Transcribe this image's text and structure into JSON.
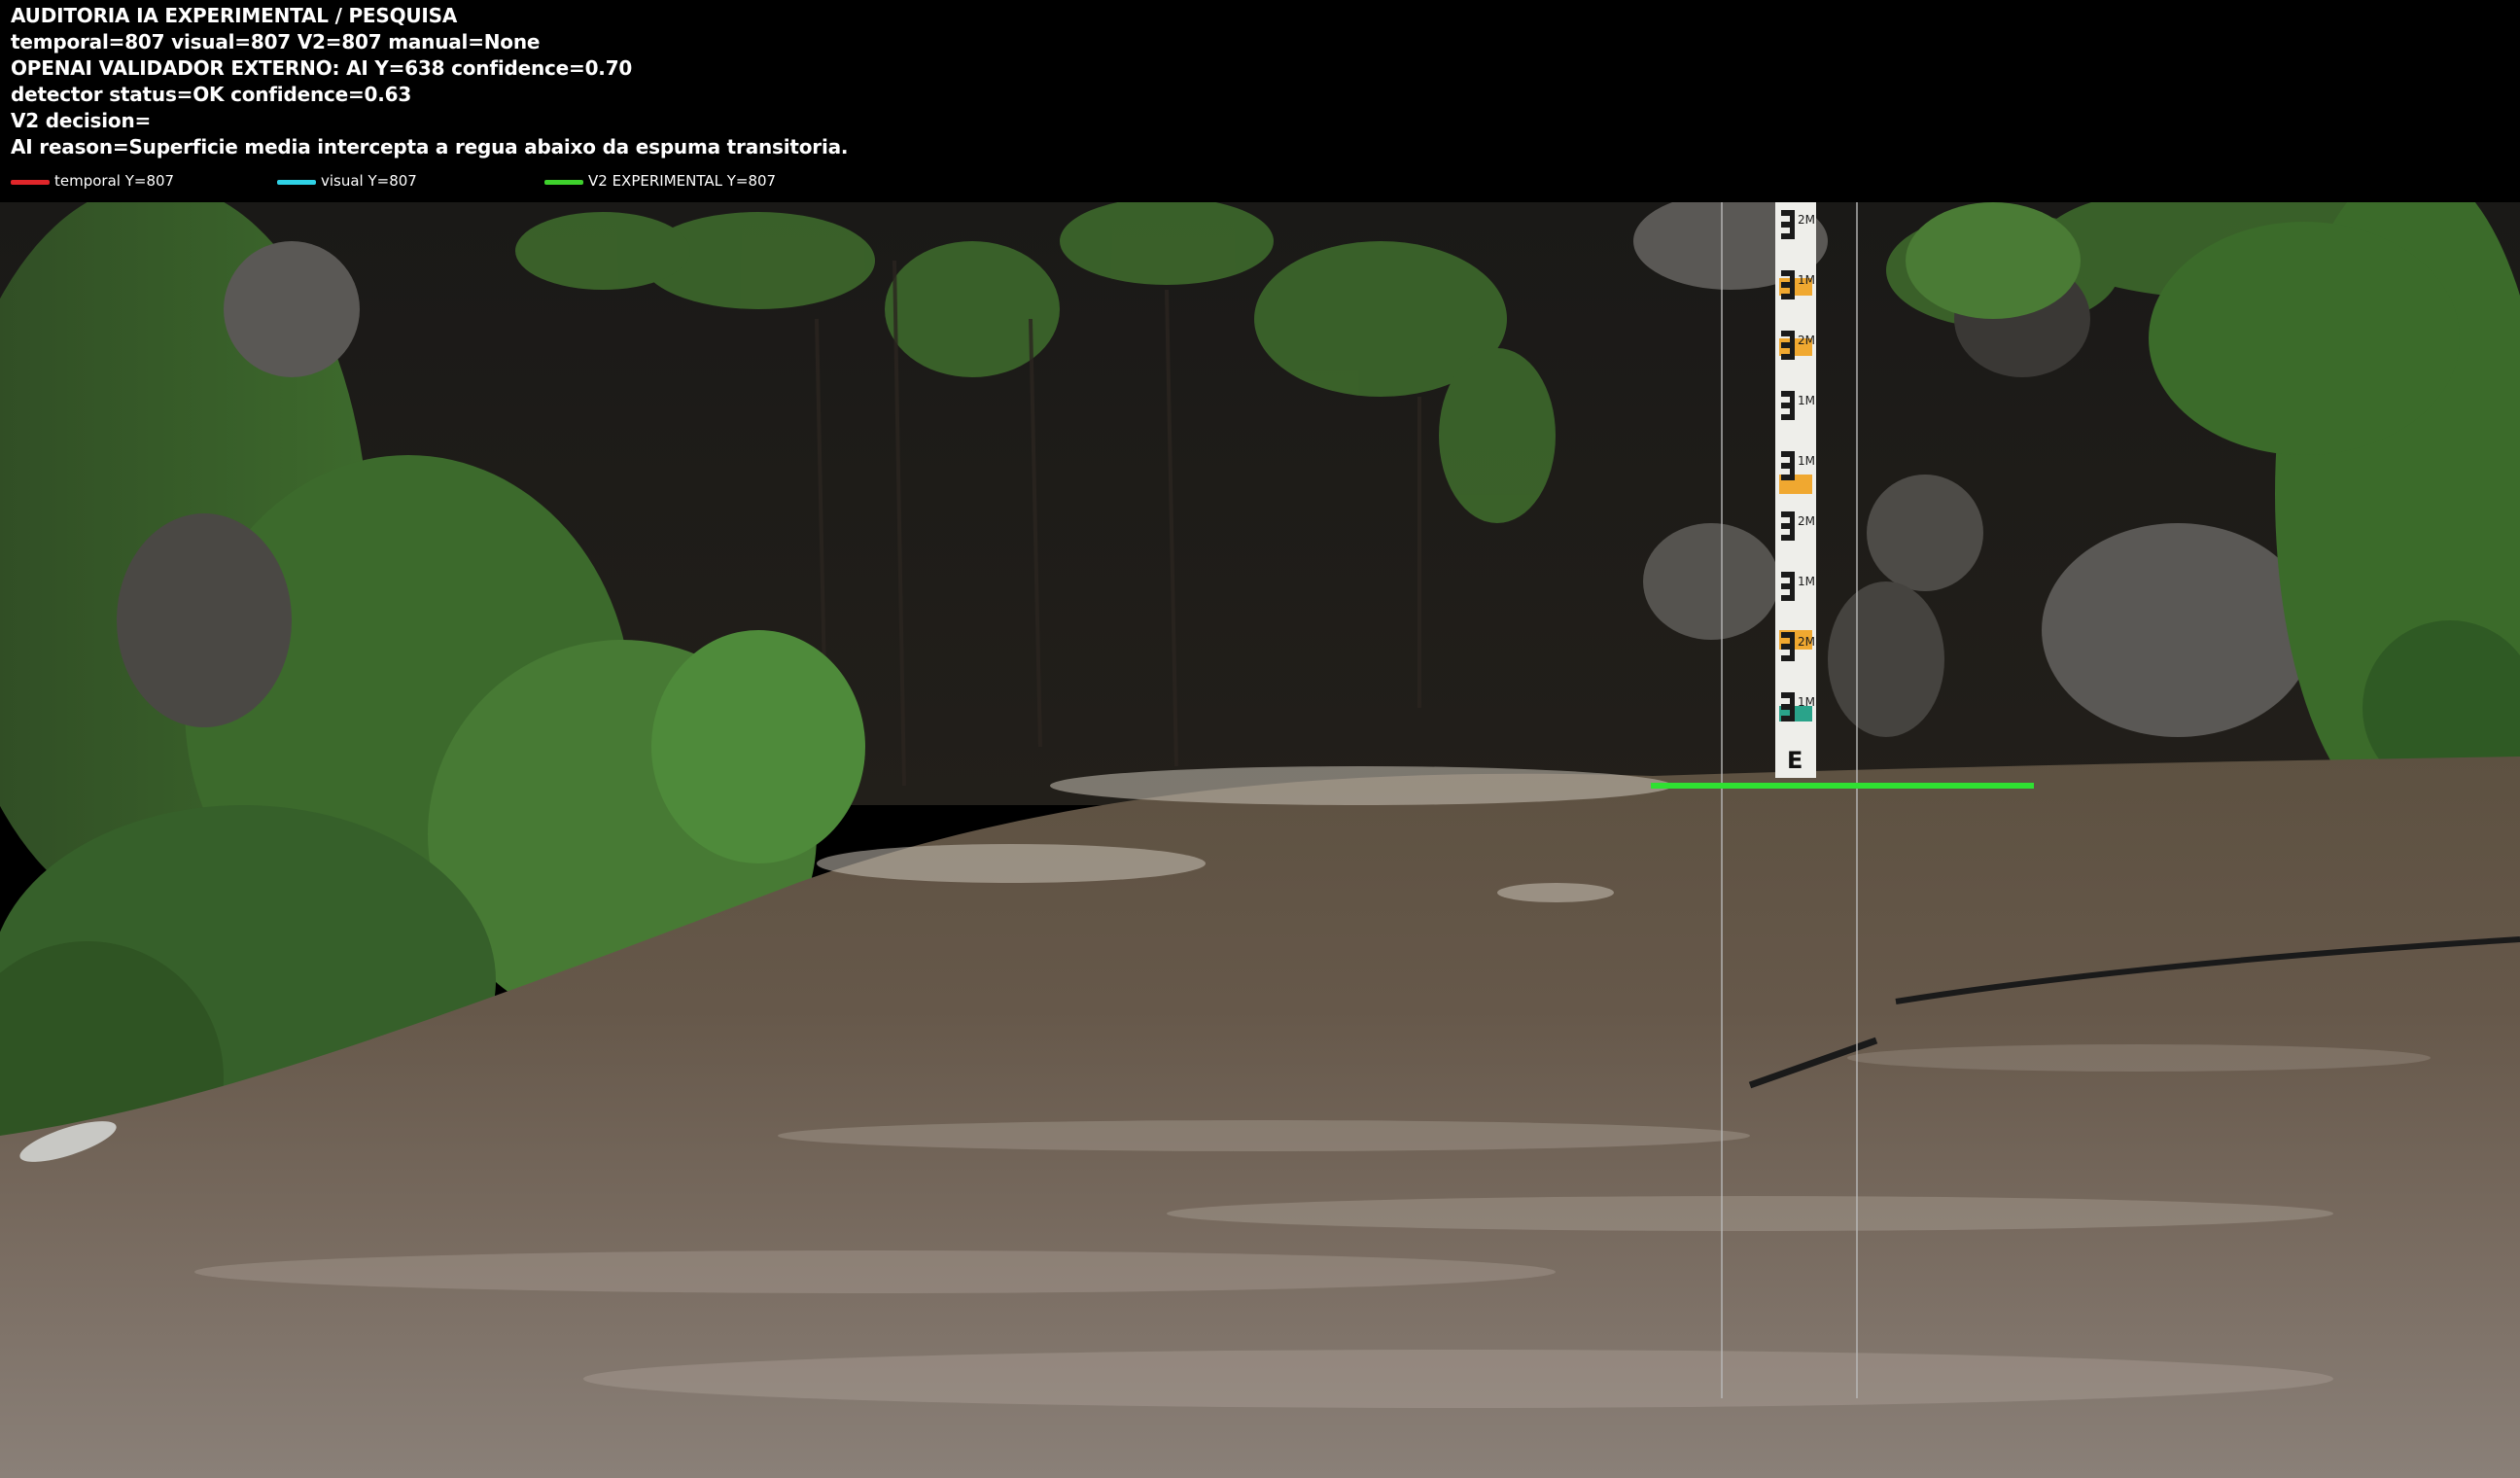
{
  "hud": {
    "lines": [
      "AUDITORIA IA  EXPERIMENTAL / PESQUISA",
      "temporal=807  visual=807  V2=807  manual=None",
      "OPENAI  VALIDADOR EXTERNO: AI Y=638  confidence=0.70",
      "detector status=OK confidence=0.63",
      "V2 decision=",
      "AI reason=Superficie media intercepta a regua abaixo da espuma transitoria."
    ],
    "legend": [
      {
        "label": "temporal Y=807",
        "color": "#e0262a"
      },
      {
        "label": "visual Y=807",
        "color": "#2fd2e6"
      },
      {
        "label": "V2 EXPERIMENTAL Y=807",
        "color": "#3ed12c"
      }
    ]
  },
  "scene": {
    "gauge_letter": "E",
    "gauge_marks": [
      "2M",
      "1M",
      "2M",
      "1M",
      "1M",
      "2M",
      "1M",
      "2M",
      "1M"
    ],
    "waterline_color": "#2fe032"
  }
}
